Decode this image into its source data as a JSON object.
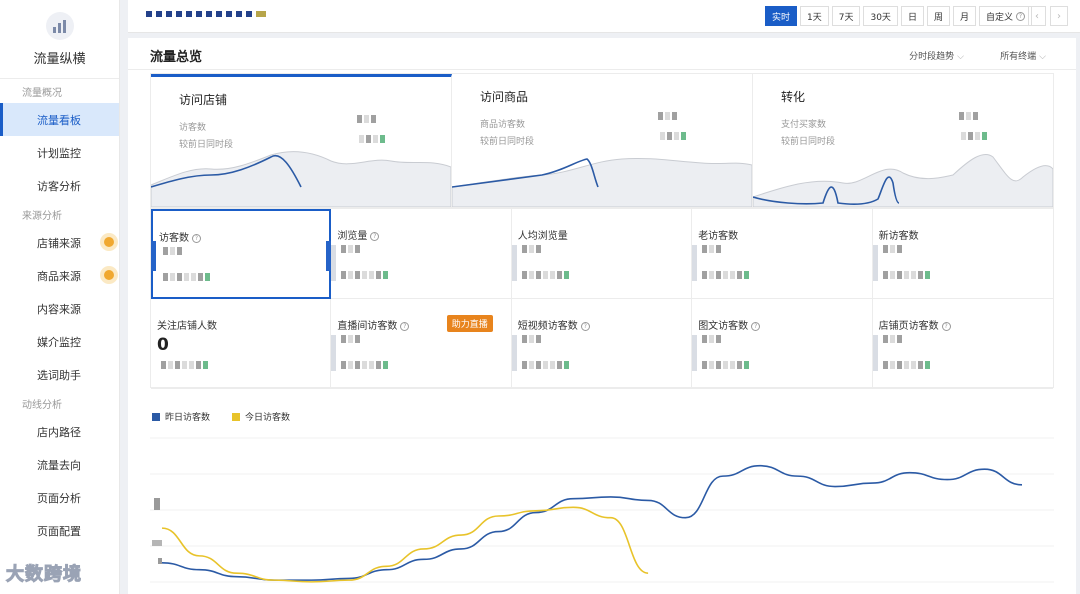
{
  "sidebar": {
    "logo_text": "流量纵横",
    "groups": [
      {
        "label": "流量概况",
        "items": [
          {
            "label": "流量看板",
            "active": true,
            "dot": false
          },
          {
            "label": "计划监控",
            "active": false,
            "dot": false
          },
          {
            "label": "访客分析",
            "active": false,
            "dot": false
          }
        ]
      },
      {
        "label": "来源分析",
        "items": [
          {
            "label": "店铺来源",
            "active": false,
            "dot": true
          },
          {
            "label": "商品来源",
            "active": false,
            "dot": true
          },
          {
            "label": "内容来源",
            "active": false,
            "dot": false
          },
          {
            "label": "媒介监控",
            "active": false,
            "dot": false
          },
          {
            "label": "选词助手",
            "active": false,
            "dot": false
          }
        ]
      },
      {
        "label": "动线分析",
        "items": [
          {
            "label": "店内路径",
            "active": false,
            "dot": false
          },
          {
            "label": "流量去向",
            "active": false,
            "dot": false
          },
          {
            "label": "页面分析",
            "active": false,
            "dot": false
          },
          {
            "label": "页面配置",
            "active": false,
            "dot": false
          }
        ]
      }
    ]
  },
  "topbar": {
    "time_tabs": [
      {
        "label": "实时",
        "active": true
      },
      {
        "label": "1天",
        "active": false
      },
      {
        "label": "7天",
        "active": false
      },
      {
        "label": "30天",
        "active": false
      },
      {
        "label": "日",
        "active": false
      },
      {
        "label": "周",
        "active": false
      },
      {
        "label": "月",
        "active": false
      },
      {
        "label": "自定义",
        "active": false
      }
    ],
    "prev": "‹",
    "next": "›"
  },
  "panel": {
    "title": "流量总览",
    "trend_dropdown": "分时段趋势",
    "terminal_dropdown": "所有终端"
  },
  "overview": [
    {
      "title": "访问店铺",
      "line1": "访客数",
      "line2": "较前日同时段",
      "selected": true
    },
    {
      "title": "访问商品",
      "line1": "商品访客数",
      "line2": "较前日同时段",
      "selected": false
    },
    {
      "title": "转化",
      "line1": "支付买家数",
      "line2": "较前日同时段",
      "selected": false
    }
  ],
  "metrics": [
    {
      "label": "访客数",
      "value": "",
      "help": true,
      "selected": true
    },
    {
      "label": "浏览量",
      "value": "",
      "help": true,
      "selected": false
    },
    {
      "label": "人均浏览量",
      "value": "",
      "help": false,
      "selected": false
    },
    {
      "label": "老访客数",
      "value": "",
      "help": false,
      "selected": false
    },
    {
      "label": "新访客数",
      "value": "",
      "help": false,
      "selected": false
    },
    {
      "label": "关注店铺人数",
      "value": "0",
      "help": false,
      "selected": false
    },
    {
      "label": "直播间访客数",
      "value": "",
      "help": true,
      "selected": false,
      "badge": "助力直播"
    },
    {
      "label": "短视频访客数",
      "value": "",
      "help": true,
      "selected": false
    },
    {
      "label": "图文访客数",
      "value": "",
      "help": true,
      "selected": false
    },
    {
      "label": "店铺页访客数",
      "value": "",
      "help": true,
      "selected": false
    }
  ],
  "colors": {
    "accent": "#1a5dc7",
    "yesterday": "#2b5aa5",
    "today": "#e8c32a",
    "badge": "#e8841d",
    "dot": "#f0a830"
  },
  "chart_data": {
    "type": "line",
    "x": [
      0,
      1,
      2,
      3,
      4,
      5,
      6,
      7,
      8,
      9,
      10,
      11,
      12,
      13,
      14,
      15,
      16,
      17,
      18,
      19,
      20,
      21,
      22,
      23
    ],
    "series": [
      {
        "name": "昨日访客数",
        "values": [
          18,
          14,
          10,
          8,
          8,
          9,
          14,
          20,
          26,
          36,
          47,
          55,
          56,
          54,
          44,
          68,
          74,
          68,
          62,
          64,
          70,
          66,
          72,
          63
        ]
      },
      {
        "name": "今日访客数",
        "values": [
          38,
          22,
          12,
          8,
          7,
          8,
          16,
          26,
          34,
          45,
          48,
          50,
          44,
          12
        ]
      }
    ],
    "ylim": [
      0,
      90
    ],
    "legend": "top-left",
    "grid": true
  }
}
